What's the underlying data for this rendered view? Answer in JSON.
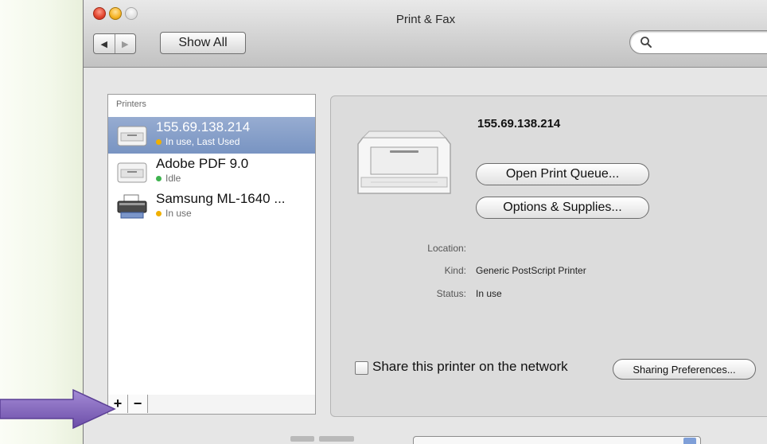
{
  "window": {
    "title": "Print & Fax"
  },
  "toolbar": {
    "back_icon": "triangle-left",
    "forward_icon": "triangle-right",
    "show_all_label": "Show All",
    "search_value": ""
  },
  "printers": {
    "header": "Printers",
    "items": [
      {
        "name": "155.69.138.214",
        "status": "In use, Last Used",
        "status_color": "#f0b000",
        "selected": true,
        "icon": "laser-printer-icon"
      },
      {
        "name": "Adobe PDF 9.0",
        "status": "Idle",
        "status_color": "#3fb34f",
        "selected": false,
        "icon": "laser-printer-icon"
      },
      {
        "name": "Samsung ML-1640 ...",
        "status": "In use",
        "status_color": "#f0b000",
        "selected": false,
        "icon": "inkjet-printer-icon"
      }
    ],
    "add_label": "+",
    "remove_label": "−"
  },
  "detail": {
    "printer_name": "155.69.138.214",
    "open_queue_label": "Open Print Queue...",
    "options_label": "Options & Supplies...",
    "location_label": "Location:",
    "location_value": "",
    "kind_label": "Kind:",
    "kind_value": "Generic PostScript Printer",
    "status_label": "Status:",
    "status_value": "In use",
    "share_label": "Share this printer on the network",
    "share_checked": false,
    "sharing_prefs_label": "Sharing Preferences..."
  },
  "colors": {
    "selection": "#7f99c6",
    "arrow": "#8a6bbf",
    "panel": "#dcdcdc"
  }
}
